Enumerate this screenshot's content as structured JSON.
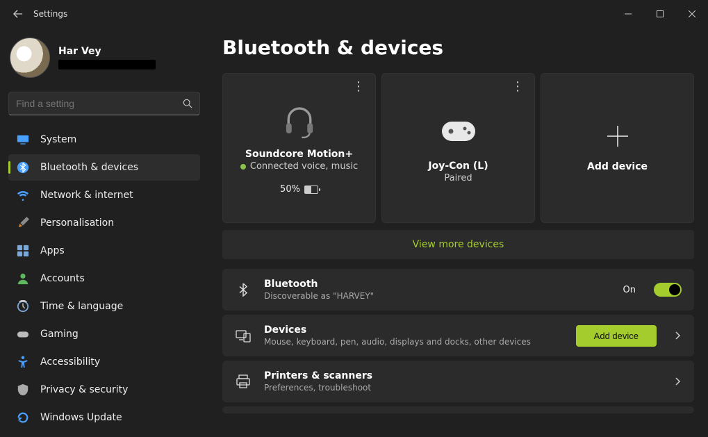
{
  "window": {
    "title": "Settings"
  },
  "user": {
    "name": "Har Vey"
  },
  "search": {
    "placeholder": "Find a setting"
  },
  "sidebar": [
    {
      "key": "system",
      "label": "System"
    },
    {
      "key": "bluetooth",
      "label": "Bluetooth & devices"
    },
    {
      "key": "network",
      "label": "Network & internet"
    },
    {
      "key": "personalisation",
      "label": "Personalisation"
    },
    {
      "key": "apps",
      "label": "Apps"
    },
    {
      "key": "accounts",
      "label": "Accounts"
    },
    {
      "key": "time",
      "label": "Time & language"
    },
    {
      "key": "gaming",
      "label": "Gaming"
    },
    {
      "key": "accessibility",
      "label": "Accessibility"
    },
    {
      "key": "privacy",
      "label": "Privacy & security"
    },
    {
      "key": "update",
      "label": "Windows Update"
    }
  ],
  "page": {
    "title": "Bluetooth & devices",
    "viewmore": "View more devices",
    "add_card_label": "Add device"
  },
  "devices": [
    {
      "name": "Soundcore Motion+",
      "status": "Connected voice, music",
      "connected": true,
      "battery": "50%"
    },
    {
      "name": "Joy-Con (L)",
      "status": "Paired",
      "connected": false
    }
  ],
  "bluetooth_row": {
    "title": "Bluetooth",
    "sub": "Discoverable as \"HARVEY\"",
    "toggle_label": "On",
    "toggle_on": true
  },
  "rows": [
    {
      "key": "devices",
      "title": "Devices",
      "sub": "Mouse, keyboard, pen, audio, displays and docks, other devices",
      "button": "Add device"
    },
    {
      "key": "printers",
      "title": "Printers & scanners",
      "sub": "Preferences, troubleshoot"
    }
  ]
}
